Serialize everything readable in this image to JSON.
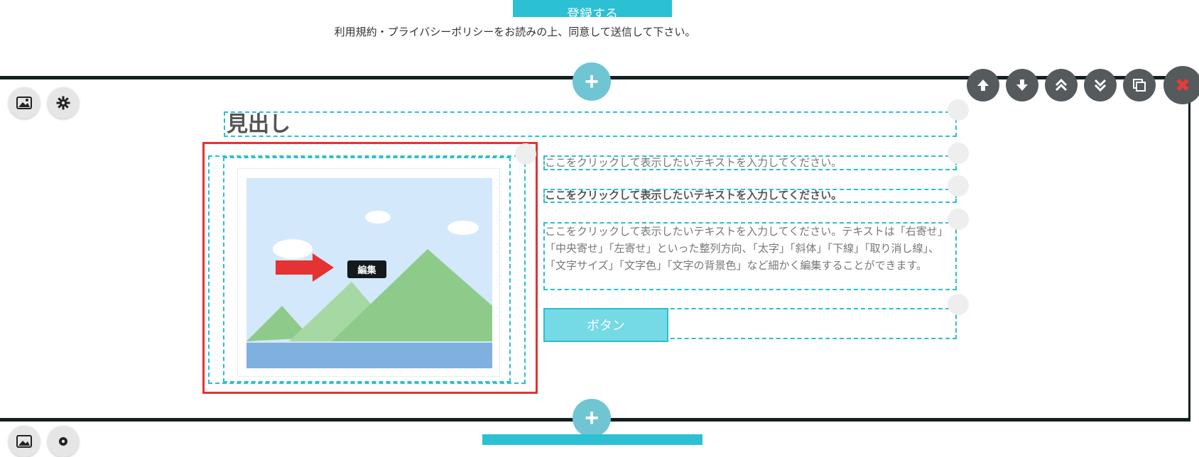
{
  "top": {
    "submit_label": "登録する",
    "terms_text": "利用規約・プライバシーポリシーをお読みの上、同意して送信して下さい。"
  },
  "section_toolbar": {
    "add_label": "+",
    "image_icon": "image-icon",
    "settings_icon": "gear-icon",
    "controls": [
      "arrow-up-icon",
      "arrow-down-icon",
      "double-chevron-up-icon",
      "double-chevron-down-icon",
      "copy-icon",
      "delete-icon"
    ],
    "delete_glyph": "✖"
  },
  "content": {
    "heading": "見出し",
    "text1": "ここをクリックして表示したいテキストを入力してください。",
    "text2": "ここをクリックして表示したいテキストを入力してください。",
    "paragraph": "ここをクリックして表示したいテキストを入力してください。テキストは「右寄せ」「中央寄せ」「左寄せ」といった整列方向、「太字」「斜体」「下線」「取り消し線」、「文字サイズ」「文字色」「文字の背景色」など細かく編集することができます。",
    "button_label": "ボタン",
    "edit_tag": "編集"
  },
  "colors": {
    "accent": "#2bc0d4",
    "highlight_red": "#e53232",
    "dark_frame": "#142020"
  }
}
